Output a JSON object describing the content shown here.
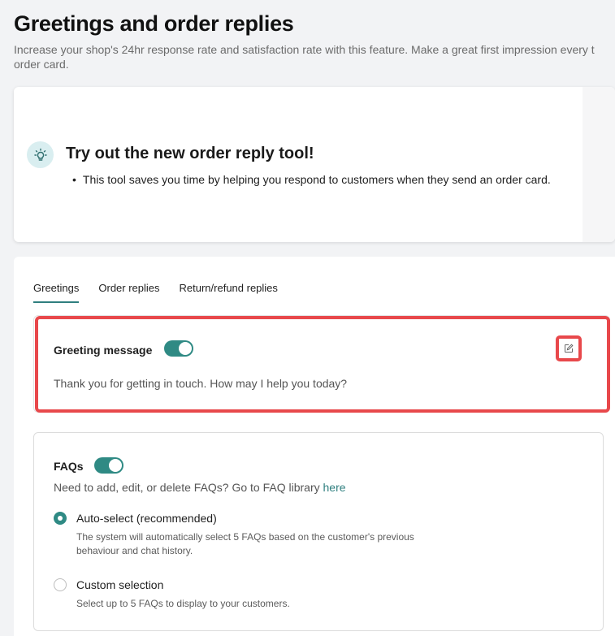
{
  "page": {
    "title": "Greetings and order replies",
    "description_line1": "Increase your shop's 24hr response rate and satisfaction rate with this feature. Make a great first impression every t",
    "description_line2": "order card."
  },
  "promo": {
    "title": "Try out the new order reply tool!",
    "bullet": "This tool saves you time by helping you respond to customers when they send an order card.",
    "icon": "lightbulb-icon"
  },
  "tabs": [
    {
      "label": "Greetings",
      "active": true
    },
    {
      "label": "Order replies",
      "active": false
    },
    {
      "label": "Return/refund replies",
      "active": false
    }
  ],
  "greeting": {
    "label": "Greeting message",
    "enabled": true,
    "message": "Thank you for getting in touch. How may I help you today?",
    "edit_icon": "edit-icon"
  },
  "faqs": {
    "label": "FAQs",
    "enabled": true,
    "help_text": "Need to add, edit, or delete FAQs? Go to FAQ library ",
    "help_link": "here",
    "options": [
      {
        "label": "Auto-select (recommended)",
        "description": "The system will automatically select 5 FAQs based on the customer's previous behaviour and chat history.",
        "selected": true
      },
      {
        "label": "Custom selection",
        "description": "Select up to 5 FAQs to display to your customers.",
        "selected": false
      }
    ]
  },
  "colors": {
    "accent": "#2f8a84",
    "highlight": "#e8484b",
    "background": "#f2f3f5"
  }
}
